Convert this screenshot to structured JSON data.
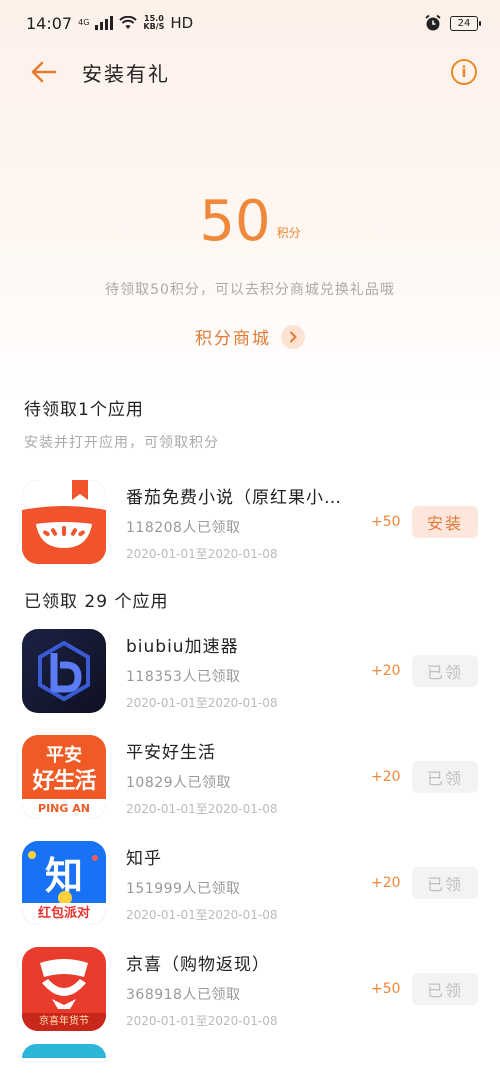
{
  "status_bar": {
    "time": "14:07",
    "network": "4G",
    "speed_top": "15.0",
    "speed_bottom": "KB/S",
    "hd": "HD",
    "battery": "24"
  },
  "header": {
    "title": "安装有礼",
    "back_icon": "arrow-left-icon",
    "info_icon": "info-icon",
    "info_glyph": "i"
  },
  "points": {
    "value": "50",
    "unit": "积分",
    "description": "待领取50积分，可以去积分商城兑换礼品哦",
    "mall_link": "积分商城"
  },
  "pending": {
    "title": "待领取1个应用",
    "subtitle": "安装并打开应用，可领取积分",
    "apps": [
      {
        "name": "番茄免费小说（原红果小…",
        "count": "118208人已领取",
        "date": "2020-01-01至2020-01-08",
        "points": "+50",
        "button": "安装"
      }
    ]
  },
  "claimed": {
    "title": "已领取 29 个应用",
    "apps": [
      {
        "name": "biubiu加速器",
        "count": "118353人已领取",
        "date": "2020-01-01至2020-01-08",
        "points": "+20",
        "button": "已领"
      },
      {
        "name": "平安好生活",
        "count": "10829人已领取",
        "date": "2020-01-01至2020-01-08",
        "points": "+20",
        "button": "已领",
        "icon_text_top": "平安",
        "icon_text_mid": "好生活",
        "icon_text_bottom": "PING AN"
      },
      {
        "name": "知乎",
        "count": "151999人已领取",
        "date": "2020-01-01至2020-01-08",
        "points": "+20",
        "button": "已领",
        "icon_text_top": "知",
        "icon_text_bottom": "红包派对"
      },
      {
        "name": "京喜（购物返现）",
        "count": "368918人已领取",
        "date": "2020-01-01至2020-01-08",
        "points": "+50",
        "button": "已领",
        "icon_text_bottom": "京喜年货节"
      }
    ]
  },
  "colors": {
    "accent": "#f0883a",
    "install_bg": "#fde7dc",
    "claimed_bg": "#f3f3f3"
  }
}
